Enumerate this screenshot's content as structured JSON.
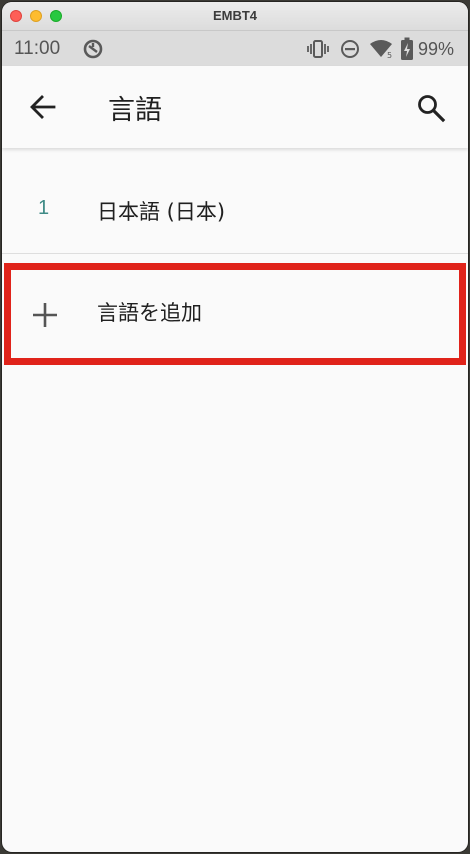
{
  "window": {
    "title": "EMBT4"
  },
  "status_bar": {
    "time": "11:00",
    "battery_percent": "99%"
  },
  "app_bar": {
    "title": "言語",
    "back_icon": "arrow-left-icon",
    "search_icon": "search-icon"
  },
  "languages": [
    {
      "index": "1",
      "name": "日本語 (日本)"
    }
  ],
  "add_language": {
    "label": "言語を追加",
    "icon": "plus-icon"
  },
  "colors": {
    "highlight": "#e0231a",
    "index_accent": "#3f8a86"
  }
}
